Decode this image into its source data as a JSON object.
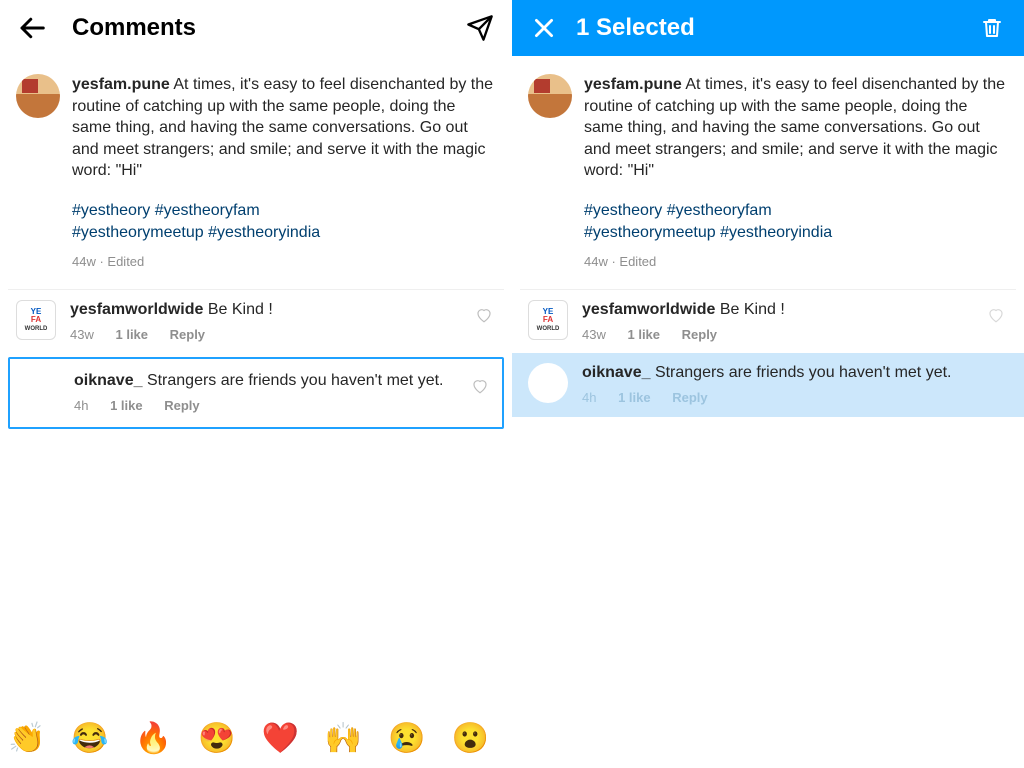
{
  "left": {
    "header": {
      "title": "Comments"
    },
    "post": {
      "handle": "yesfam.pune",
      "text": "At times, it's easy to feel disenchanted by the routine of catching up with the same people, doing the same thing, and having the same conversations. Go out and meet strangers; and smile; and serve it with the magic word: \"Hi\"",
      "hashtags_line1": "#yestheory #yestheoryfam",
      "hashtags_line2": "#yestheorymeetup #yestheoryindia",
      "meta": "44w · Edited"
    },
    "comments": [
      {
        "handle": "yesfamworldwide",
        "text": "Be Kind !",
        "age": "43w",
        "likes": "1 like",
        "reply": "Reply"
      },
      {
        "handle": "oiknave_",
        "text": "Strangers are friends you haven't met yet.",
        "age": "4h",
        "likes": "1 like",
        "reply": "Reply"
      }
    ],
    "emoji": [
      "👏",
      "😂",
      "🔥",
      "😍",
      "❤️",
      "🙌",
      "😢",
      "😮"
    ]
  },
  "right": {
    "header": {
      "title": "1 Selected"
    },
    "post": {
      "handle": "yesfam.pune",
      "text": "At times, it's easy to feel disenchanted by the routine of catching up with the same people, doing the same thing, and having the same conversations. Go out and meet strangers; and smile; and serve it with the magic word: \"Hi\"",
      "hashtags_line1": "#yestheory #yestheoryfam",
      "hashtags_line2": "#yestheorymeetup #yestheoryindia",
      "meta": "44w · Edited"
    },
    "comments": [
      {
        "handle": "yesfamworldwide",
        "text": "Be Kind !",
        "age": "43w",
        "likes": "1 like",
        "reply": "Reply"
      },
      {
        "handle": "oiknave_",
        "text": "Strangers are friends you haven't met yet.",
        "age": "4h",
        "likes": "1 like",
        "reply": "Reply"
      }
    ]
  }
}
